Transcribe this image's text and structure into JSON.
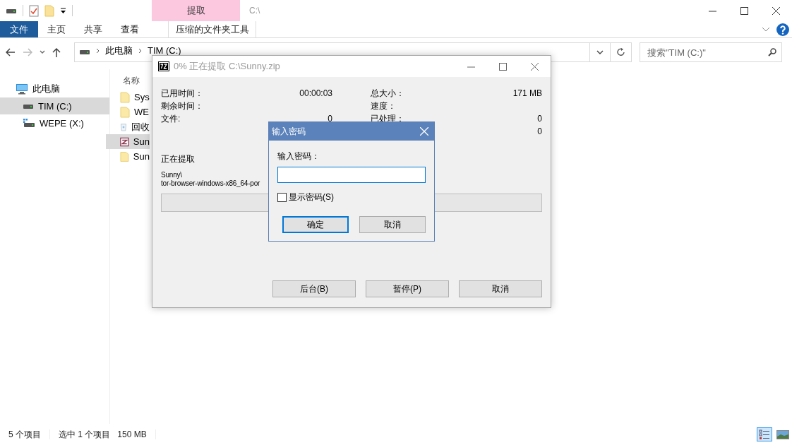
{
  "title_bar": {
    "contextual_tab": "提取",
    "path": "C:\\"
  },
  "ribbon_tabs": [
    {
      "label": "文件",
      "kind": "file",
      "selected": false
    },
    {
      "label": "主页",
      "kind": "tab",
      "selected": false
    },
    {
      "label": "共享",
      "kind": "tab",
      "selected": false
    },
    {
      "label": "查看",
      "kind": "tab",
      "selected": false
    },
    {
      "label": "压缩的文件夹工具",
      "kind": "contextual",
      "selected": false
    }
  ],
  "address_bar": {
    "crumbs": [
      "此电脑",
      "TIM (C:)"
    ],
    "search_placeholder": "搜索\"TIM (C:)\""
  },
  "navigation": [
    {
      "label": "此电脑",
      "kind": "pc",
      "selected": false,
      "children": [
        {
          "label": "TIM (C:)",
          "kind": "drive",
          "selected": true
        },
        {
          "label": "WEPE (X:)",
          "kind": "usb",
          "selected": false
        }
      ]
    }
  ],
  "file_list": {
    "column": "名称",
    "items": [
      {
        "name": "Sys",
        "kind": "folder",
        "selected": false
      },
      {
        "name": "WE",
        "kind": "folder",
        "selected": false
      },
      {
        "name": "回收",
        "kind": "recycle",
        "selected": false
      },
      {
        "name": "Sun",
        "kind": "zip",
        "selected": true
      },
      {
        "name": "Sun",
        "kind": "folder",
        "selected": false
      }
    ]
  },
  "status_bar": {
    "count": "5 个项目",
    "selection": "选中 1 个项目",
    "size": "150 MB",
    "views": [
      {
        "kind": "details",
        "selected": true
      },
      {
        "kind": "thumbnails",
        "selected": false
      }
    ]
  },
  "extract_window": {
    "title": "0% 正在提取 C:\\Sunny.zip",
    "left_stats": [
      {
        "label": "已用时间：",
        "value": "00:00:03"
      },
      {
        "label": "剩余时间："
      },
      {
        "label": "文件:",
        "value": "0"
      }
    ],
    "right_stats": [
      {
        "label": "总大小：",
        "value": "171 MB"
      },
      {
        "label": "速度："
      },
      {
        "label": "已处理：",
        "value": "0"
      },
      {
        "value": "0"
      }
    ],
    "current_label": "正在提取",
    "current_path": [
      "Sunny\\",
      "tor-browser-windows-x86_64-por"
    ],
    "progress": {
      "level": 0
    },
    "buttons": [
      "后台(B)",
      "暂停(P)",
      "取消"
    ]
  },
  "password_dialog": {
    "title": "输入密码",
    "label": "输入密码：",
    "show_password": {
      "label": "显示密码(S)",
      "checked": false
    },
    "buttons": [
      {
        "label": "确定",
        "default": true
      },
      {
        "label": "取消",
        "default": false
      }
    ]
  }
}
